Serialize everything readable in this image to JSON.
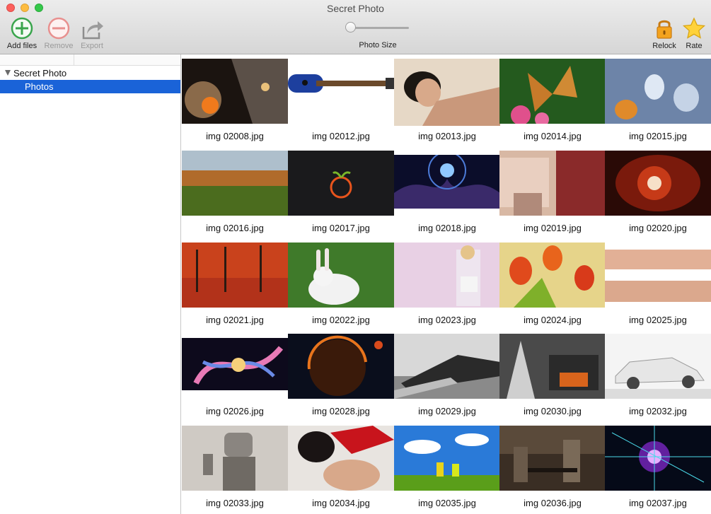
{
  "window": {
    "title": "Secret Photo"
  },
  "toolbar": {
    "add_label": "Add files",
    "remove_label": "Remove",
    "export_label": "Export",
    "relock_label": "Relock",
    "rate_label": "Rate",
    "photo_size_label": "Photo Size",
    "photo_size_value": 0
  },
  "sidebar": {
    "items": [
      {
        "label": "Secret Photo",
        "expanded": true
      },
      {
        "label": "Photos",
        "selected": true
      }
    ]
  },
  "grid": {
    "photos": [
      {
        "name": "img 02008.jpg",
        "icon": "space-planet"
      },
      {
        "name": "img 02012.jpg",
        "icon": "guitar"
      },
      {
        "name": "img 02013.jpg",
        "icon": "portrait"
      },
      {
        "name": "img 02014.jpg",
        "icon": "butterfly"
      },
      {
        "name": "img 02015.jpg",
        "icon": "fish"
      },
      {
        "name": "img 02016.jpg",
        "icon": "autumn-field"
      },
      {
        "name": "img 02017.jpg",
        "icon": "orange-logo"
      },
      {
        "name": "img 02018.jpg",
        "icon": "fractal"
      },
      {
        "name": "img 02019.jpg",
        "icon": "painting-street"
      },
      {
        "name": "img 02020.jpg",
        "icon": "red-eye"
      },
      {
        "name": "img 02021.jpg",
        "icon": "autumn-trees"
      },
      {
        "name": "img 02022.jpg",
        "icon": "rabbit"
      },
      {
        "name": "img 02023.jpg",
        "icon": "model-lilac"
      },
      {
        "name": "img 02024.jpg",
        "icon": "tulips"
      },
      {
        "name": "img 02025.jpg",
        "icon": "crowd"
      },
      {
        "name": "img 02026.jpg",
        "icon": "abstract-light"
      },
      {
        "name": "img 02028.jpg",
        "icon": "dark-planet"
      },
      {
        "name": "img 02029.jpg",
        "icon": "bw-legs"
      },
      {
        "name": "img 02030.jpg",
        "icon": "fireplace"
      },
      {
        "name": "img 02032.jpg",
        "icon": "white-car"
      },
      {
        "name": "img 02033.jpg",
        "icon": "robot"
      },
      {
        "name": "img 02034.jpg",
        "icon": "santa-girl"
      },
      {
        "name": "img 02035.jpg",
        "icon": "meadow-sky"
      },
      {
        "name": "img 02036.jpg",
        "icon": "soldiers"
      },
      {
        "name": "img 02037.jpg",
        "icon": "nebula"
      }
    ]
  }
}
